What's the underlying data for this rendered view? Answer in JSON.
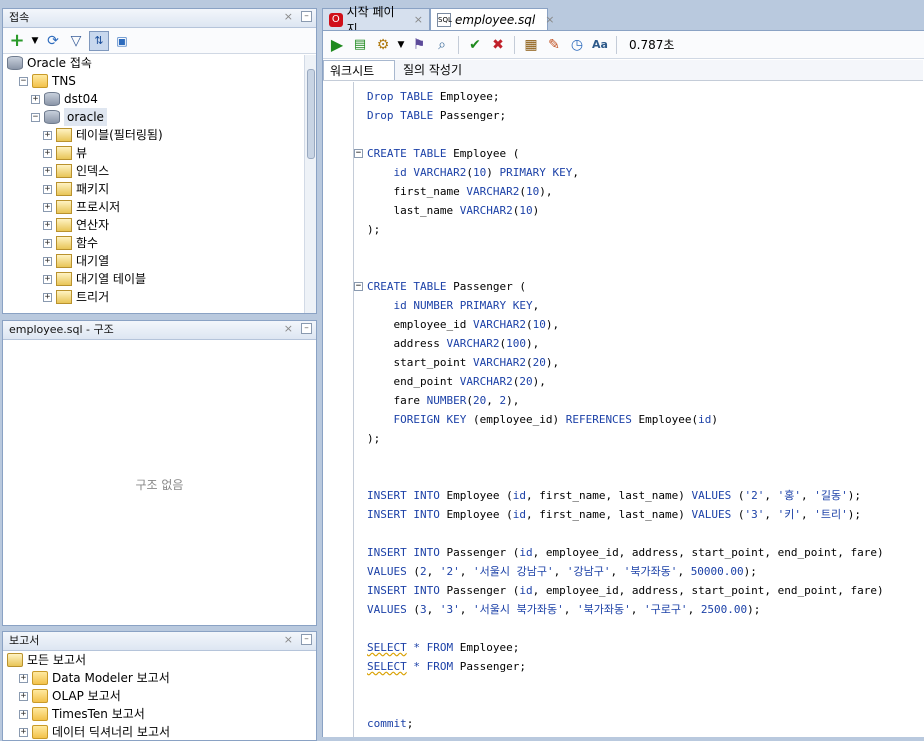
{
  "connections": {
    "title": "접속",
    "tree": [
      {
        "label": "Oracle 접속",
        "level": 0,
        "icon": "db",
        "exp": ""
      },
      {
        "label": "TNS",
        "level": 1,
        "icon": "folder",
        "exp": "−"
      },
      {
        "label": "dst04",
        "level": 2,
        "icon": "db",
        "exp": "+"
      },
      {
        "label": "oracle",
        "level": 2,
        "icon": "db",
        "exp": "−"
      },
      {
        "label": "테이블(필터링됨)",
        "level": 3,
        "icon": "obj",
        "exp": "+"
      },
      {
        "label": "뷰",
        "level": 3,
        "icon": "obj",
        "exp": "+"
      },
      {
        "label": "인덱스",
        "level": 3,
        "icon": "obj",
        "exp": "+"
      },
      {
        "label": "패키지",
        "level": 3,
        "icon": "obj",
        "exp": "+"
      },
      {
        "label": "프로시저",
        "level": 3,
        "icon": "obj",
        "exp": "+"
      },
      {
        "label": "연산자",
        "level": 3,
        "icon": "obj",
        "exp": "+"
      },
      {
        "label": "함수",
        "level": 3,
        "icon": "obj",
        "exp": "+"
      },
      {
        "label": "대기열",
        "level": 3,
        "icon": "obj",
        "exp": "+"
      },
      {
        "label": "대기열 테이블",
        "level": 3,
        "icon": "obj",
        "exp": "+"
      },
      {
        "label": "트리거",
        "level": 3,
        "icon": "obj",
        "exp": "+"
      }
    ]
  },
  "structure": {
    "title": "employee.sql - 구조",
    "empty_text": "구조 없음"
  },
  "reports": {
    "title": "보고서",
    "tree": [
      {
        "label": "모든 보고서",
        "level": 0,
        "icon": "report",
        "exp": ""
      },
      {
        "label": "Data Modeler 보고서",
        "level": 1,
        "icon": "folder",
        "exp": "+"
      },
      {
        "label": "OLAP 보고서",
        "level": 1,
        "icon": "folder",
        "exp": "+"
      },
      {
        "label": "TimesTen 보고서",
        "level": 1,
        "icon": "folder",
        "exp": "+"
      },
      {
        "label": "데이터 딕셔너리 보고서",
        "level": 1,
        "icon": "folder",
        "exp": "+"
      }
    ]
  },
  "editor": {
    "tabs": [
      {
        "label": "시작 페이지",
        "active": false
      },
      {
        "label": "employee.sql",
        "active": true
      }
    ],
    "timing": "0.787초",
    "subtabs": [
      "워크시트",
      "질의 작성기"
    ],
    "code_lines": [
      {
        "y": 0,
        "html": "<span class='kw'>Drop TABLE</span> Employee;"
      },
      {
        "y": 1,
        "html": "<span class='kw'>Drop TABLE</span> Passenger;"
      },
      {
        "y": 3,
        "html": "<span class='kw'>CREATE TABLE</span> Employee (",
        "fold": true
      },
      {
        "y": 4,
        "html": "    <span class='kw'>id VARCHAR2</span>(<span class='num'>10</span>) <span class='kw'>PRIMARY KEY</span>,"
      },
      {
        "y": 5,
        "html": "    first_name <span class='kw'>VARCHAR2</span>(<span class='num'>10</span>),"
      },
      {
        "y": 6,
        "html": "    last_name <span class='kw'>VARCHAR2</span>(<span class='num'>10</span>)"
      },
      {
        "y": 7,
        "html": ");"
      },
      {
        "y": 10,
        "html": "<span class='kw'>CREATE TABLE</span> Passenger (",
        "fold": true
      },
      {
        "y": 11,
        "html": "    <span class='kw'>id NUMBER PRIMARY KEY</span>,"
      },
      {
        "y": 12,
        "html": "    employee_id <span class='kw'>VARCHAR2</span>(<span class='num'>10</span>),"
      },
      {
        "y": 13,
        "html": "    address <span class='kw'>VARCHAR2</span>(<span class='num'>100</span>),"
      },
      {
        "y": 14,
        "html": "    start_point <span class='kw'>VARCHAR2</span>(<span class='num'>20</span>),"
      },
      {
        "y": 15,
        "html": "    end_point <span class='kw'>VARCHAR2</span>(<span class='num'>20</span>),"
      },
      {
        "y": 16,
        "html": "    fare <span class='kw'>NUMBER</span>(<span class='num'>20</span>, <span class='num'>2</span>),"
      },
      {
        "y": 17,
        "html": "    <span class='kw'>FOREIGN KEY</span> (employee_id) <span class='kw'>REFERENCES</span> Employee(<span class='kw'>id</span>)"
      },
      {
        "y": 18,
        "html": ");"
      },
      {
        "y": 21,
        "html": "<span class='kw'>INSERT INTO</span> Employee (<span class='kw'>id</span>, first_name, last_name) <span class='kw'>VALUES</span> (<span class='str'>'2'</span>, <span class='str'>'홍'</span>, <span class='str'>'길동'</span>);"
      },
      {
        "y": 22,
        "html": "<span class='kw'>INSERT INTO</span> Employee (<span class='kw'>id</span>, first_name, last_name) <span class='kw'>VALUES</span> (<span class='str'>'3'</span>, <span class='str'>'키'</span>, <span class='str'>'트리'</span>);"
      },
      {
        "y": 24,
        "html": "<span class='kw'>INSERT INTO</span> Passenger (<span class='kw'>id</span>, employee_id, address, start_point, end_point, fare)"
      },
      {
        "y": 25,
        "html": "<span class='kw'>VALUES</span> (<span class='num'>2</span>, <span class='str'>'2'</span>, <span class='str'>'서울시 강남구'</span>, <span class='str'>'강남구'</span>, <span class='str'>'북가좌동'</span>, <span class='num'>50000.00</span>);"
      },
      {
        "y": 26,
        "html": "<span class='kw'>INSERT INTO</span> Passenger (<span class='kw'>id</span>, employee_id, address, start_point, end_point, fare)"
      },
      {
        "y": 27,
        "html": "<span class='kw'>VALUES</span> (<span class='num'>3</span>, <span class='str'>'3'</span>, <span class='str'>'서울시 북가좌동'</span>, <span class='str'>'북가좌동'</span>, <span class='str'>'구로구'</span>, <span class='num'>2500.00</span>);"
      },
      {
        "y": 29,
        "html": "<span class='kw squig'>SELECT</span> <span class='kw'>*</span> <span class='kw'>FROM</span> Employee;"
      },
      {
        "y": 30,
        "html": "<span class='kw squig'>SELECT</span> <span class='kw'>*</span> <span class='kw'>FROM</span> Passenger;"
      },
      {
        "y": 33,
        "html": "<span class='kw'>commit</span>;"
      }
    ]
  }
}
